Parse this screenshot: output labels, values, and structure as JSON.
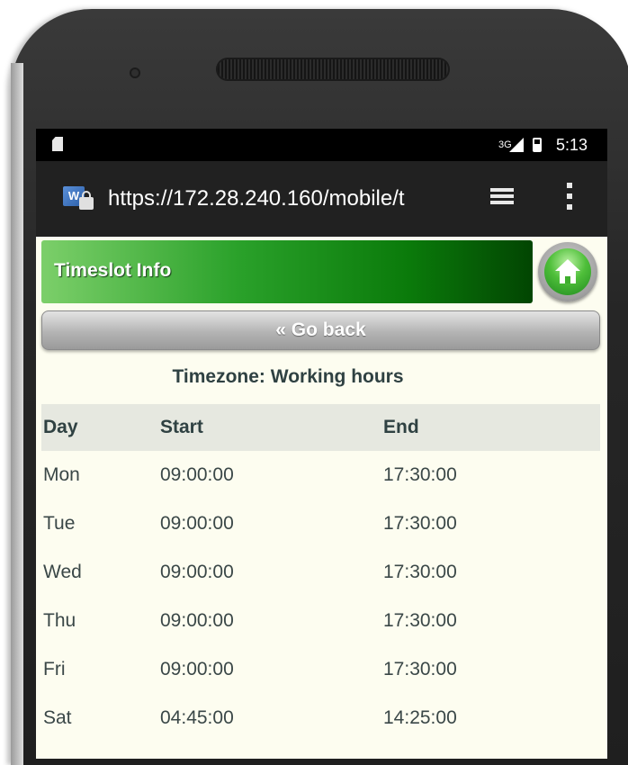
{
  "status_bar": {
    "signal": "3G",
    "time": "5:13"
  },
  "browser": {
    "url": "https://172.28.240.160/mobile/t"
  },
  "header": {
    "title": "Timeslot Info"
  },
  "back_button": {
    "label": "« Go back"
  },
  "timezone_label": "Timezone: Working hours",
  "table": {
    "headers": [
      "Day",
      "Start",
      "End"
    ],
    "rows": [
      [
        "Mon",
        "09:00:00",
        "17:30:00"
      ],
      [
        "Tue",
        "09:00:00",
        "17:30:00"
      ],
      [
        "Wed",
        "09:00:00",
        "17:30:00"
      ],
      [
        "Thu",
        "09:00:00",
        "17:30:00"
      ],
      [
        "Fri",
        "09:00:00",
        "17:30:00"
      ],
      [
        "Sat",
        "04:45:00",
        "14:25:00"
      ]
    ]
  },
  "colors": {
    "header_green": "#0a7a0a",
    "page_bg": "#fdfdf0",
    "text": "#2f4142"
  }
}
